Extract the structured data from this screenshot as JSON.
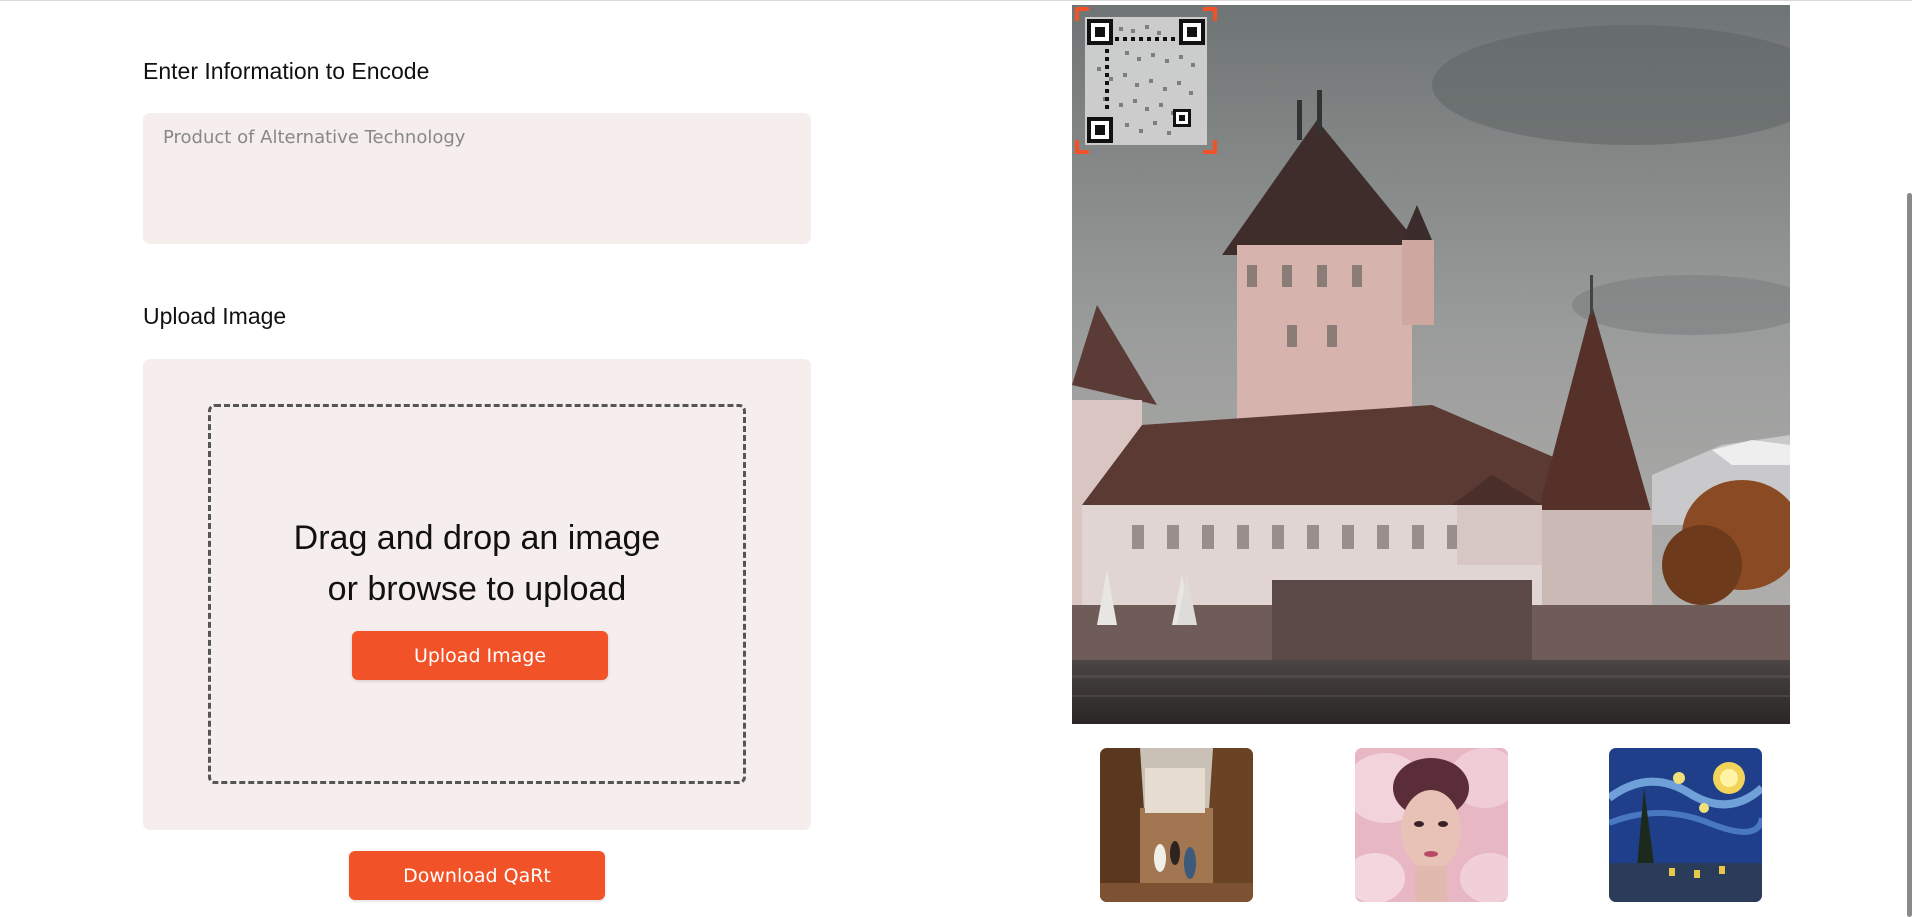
{
  "encode": {
    "label": "Enter Information to Encode",
    "placeholder": "Product of Alternative Technology",
    "value": ""
  },
  "upload": {
    "label": "Upload Image",
    "drop_text_line1": "Drag and drop an image",
    "drop_text_line2": "or browse to upload",
    "button_label": "Upload Image"
  },
  "download": {
    "button_label": "Download QaRt"
  },
  "colors": {
    "accent": "#f15227",
    "panel_bg": "#f6eeec"
  },
  "icons": {
    "qr": "qr-code-icon"
  }
}
